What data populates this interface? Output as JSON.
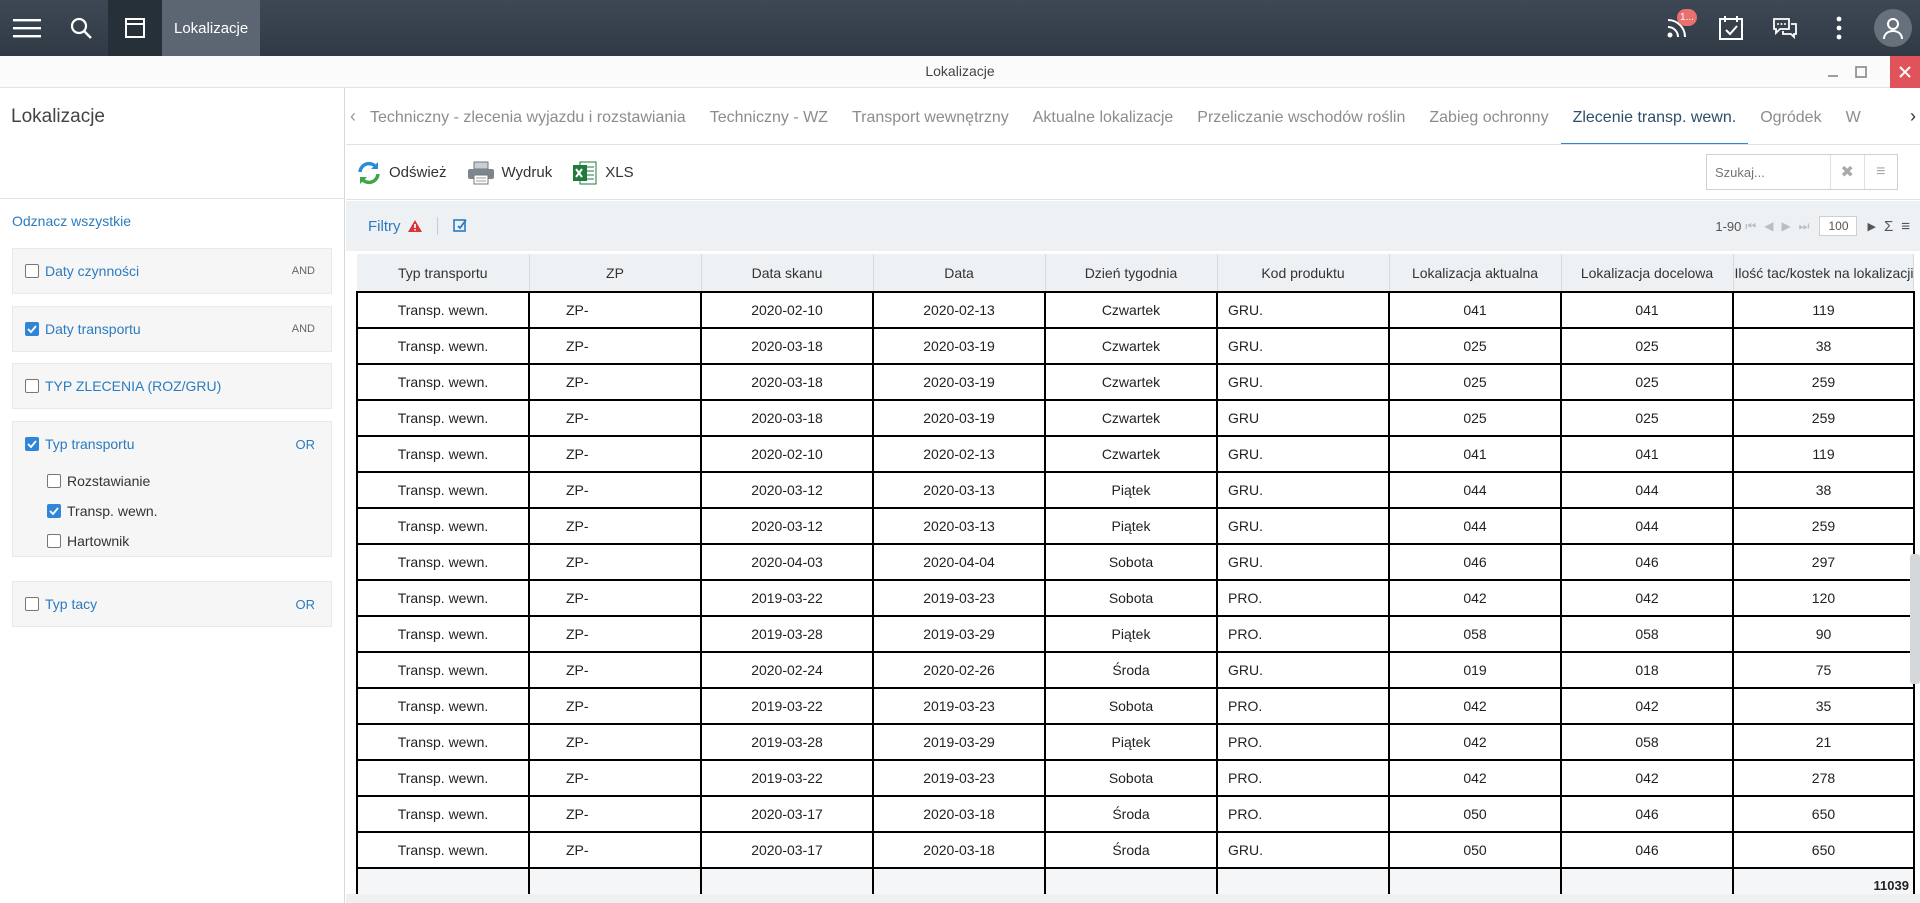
{
  "topbar": {
    "title": "Lokalizacje",
    "notifications_badge": "1..."
  },
  "window": {
    "caption": "Lokalizacje"
  },
  "left": {
    "title": "Lokalizacje",
    "uncheck_all": "Odznacz wszystkie",
    "groups": [
      {
        "label": "Daty czynności",
        "checked": false,
        "op": "AND"
      },
      {
        "label": "Daty transportu",
        "checked": true,
        "op": "AND"
      },
      {
        "label": "TYP ZLECENIA (ROZ/GRU)",
        "checked": false,
        "op": ""
      },
      {
        "label": "Typ transportu",
        "checked": true,
        "op": "OR",
        "items": [
          {
            "label": "Rozstawianie",
            "checked": false
          },
          {
            "label": "Transp. wewn.",
            "checked": true
          },
          {
            "label": "Hartownik",
            "checked": false
          }
        ]
      },
      {
        "label": "Typ tacy",
        "checked": false,
        "op": "OR"
      }
    ]
  },
  "tabs": [
    {
      "label": "Techniczny - zlecenia wyjazdu i rozstawiania",
      "active": false
    },
    {
      "label": "Techniczny - WZ",
      "active": false
    },
    {
      "label": "Transport wewnętrzny",
      "active": false
    },
    {
      "label": "Aktualne lokalizacje",
      "active": false
    },
    {
      "label": "Przeliczanie wschodów roślin",
      "active": false
    },
    {
      "label": "Zabieg ochronny",
      "active": false
    },
    {
      "label": "Zlecenie transp. wewn.",
      "active": true
    },
    {
      "label": "Ogródek",
      "active": false
    },
    {
      "label": "W",
      "active": false
    }
  ],
  "toolbar": {
    "refresh": "Odśwież",
    "print": "Wydruk",
    "xls": "XLS",
    "search_placeholder": "Szukaj..."
  },
  "gridbar": {
    "filters": "Filtry",
    "range": "1-90",
    "page_size": "100"
  },
  "table": {
    "columns": [
      "Typ transportu",
      "ZP",
      "Data skanu",
      "Data",
      "Dzień tygodnia",
      "Kod produktu",
      "Lokalizacja aktualna",
      "Lokalizacja docelowa",
      "Ilość tac/kostek na lokalizacji"
    ],
    "rows": [
      [
        "Transp. wewn.",
        "ZP-",
        "2020-02-10",
        "2020-02-13",
        "Czwartek",
        "GRU.",
        "041",
        "041",
        "119"
      ],
      [
        "Transp. wewn.",
        "ZP-",
        "2020-03-18",
        "2020-03-19",
        "Czwartek",
        "GRU.",
        "025",
        "025",
        "38"
      ],
      [
        "Transp. wewn.",
        "ZP-",
        "2020-03-18",
        "2020-03-19",
        "Czwartek",
        "GRU.",
        "025",
        "025",
        "259"
      ],
      [
        "Transp. wewn.",
        "ZP-",
        "2020-03-18",
        "2020-03-19",
        "Czwartek",
        "GRU",
        "025",
        "025",
        "259"
      ],
      [
        "Transp. wewn.",
        "ZP-",
        "2020-02-10",
        "2020-02-13",
        "Czwartek",
        "GRU.",
        "041",
        "041",
        "119"
      ],
      [
        "Transp. wewn.",
        "ZP-",
        "2020-03-12",
        "2020-03-13",
        "Piątek",
        "GRU.",
        "044",
        "044",
        "38"
      ],
      [
        "Transp. wewn.",
        "ZP-",
        "2020-03-12",
        "2020-03-13",
        "Piątek",
        "GRU.",
        "044",
        "044",
        "259"
      ],
      [
        "Transp. wewn.",
        "ZP-",
        "2020-04-03",
        "2020-04-04",
        "Sobota",
        "GRU.",
        "046",
        "046",
        "297"
      ],
      [
        "Transp. wewn.",
        "ZP-",
        "2019-03-22",
        "2019-03-23",
        "Sobota",
        "PRO.",
        "042",
        "042",
        "120"
      ],
      [
        "Transp. wewn.",
        "ZP-",
        "2019-03-28",
        "2019-03-29",
        "Piątek",
        "PRO.",
        "058",
        "058",
        "90"
      ],
      [
        "Transp. wewn.",
        "ZP-",
        "2020-02-24",
        "2020-02-26",
        "Środa",
        "GRU.",
        "019",
        "018",
        "75"
      ],
      [
        "Transp. wewn.",
        "ZP-",
        "2019-03-22",
        "2019-03-23",
        "Sobota",
        "PRO.",
        "042",
        "042",
        "35"
      ],
      [
        "Transp. wewn.",
        "ZP-",
        "2019-03-28",
        "2019-03-29",
        "Piątek",
        "PRO.",
        "042",
        "058",
        "21"
      ],
      [
        "Transp. wewn.",
        "ZP-",
        "2019-03-22",
        "2019-03-23",
        "Sobota",
        "PRO.",
        "042",
        "042",
        "278"
      ],
      [
        "Transp. wewn.",
        "ZP-",
        "2020-03-17",
        "2020-03-18",
        "Środa",
        "PRO.",
        "050",
        "046",
        "650"
      ],
      [
        "Transp. wewn.",
        "ZP-",
        "2020-03-17",
        "2020-03-18",
        "Środa",
        "GRU.",
        "050",
        "046",
        "650"
      ]
    ],
    "total": "11039"
  }
}
